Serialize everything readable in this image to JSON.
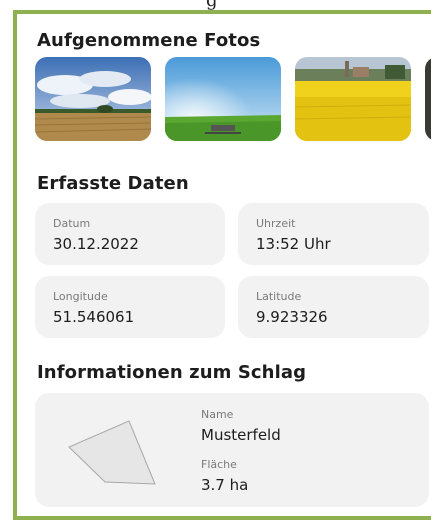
{
  "header": {
    "cut_text": "g"
  },
  "photos": {
    "title": "Aufgenommene Fotos",
    "items": [
      {
        "icon": "field-sky-photo"
      },
      {
        "icon": "grass-field-photo"
      },
      {
        "icon": "rapeseed-field-photo"
      },
      {
        "icon": "partial-photo"
      }
    ]
  },
  "data_section": {
    "title": "Erfasste Daten",
    "date": {
      "label": "Datum",
      "value": "30.12.2022"
    },
    "time": {
      "label": "Uhrzeit",
      "value": "13:52 Uhr"
    },
    "longitude": {
      "label": "Longitude",
      "value": "51.546061"
    },
    "latitude": {
      "label": "Latitude",
      "value": "9.923326"
    }
  },
  "plot": {
    "title": "Informationen zum Schlag",
    "name_label": "Name",
    "name_value": "Musterfeld",
    "area_label": "Fläche",
    "area_value": "3.7 ha"
  },
  "colors": {
    "frame": "#8fb04e",
    "card": "#f2f2f2"
  }
}
